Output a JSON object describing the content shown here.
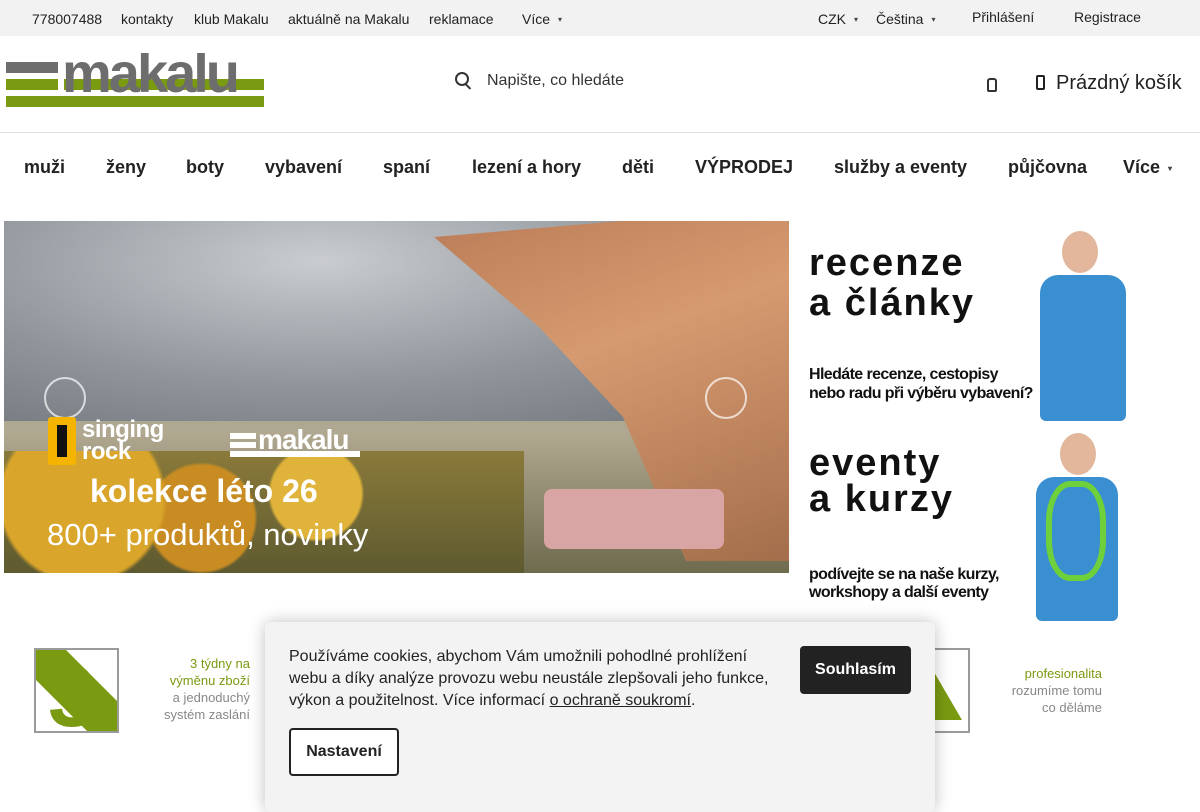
{
  "topbar": {
    "phone": "778007488",
    "links": [
      "kontakty",
      "klub Makalu",
      "aktuálně na Makalu",
      "reklamace"
    ],
    "more": "Více",
    "currency": "CZK",
    "language": "Čeština",
    "login": "Přihlášení",
    "register": "Registrace"
  },
  "header": {
    "logo_text": "makalu",
    "search_placeholder": "Napište, co hledáte",
    "cart_label": "Prázdný košík"
  },
  "nav": {
    "items": [
      "muži",
      "ženy",
      "boty",
      "vybavení",
      "spaní",
      "lezení a hory",
      "děti",
      "VÝPRODEJ",
      "služby a eventy",
      "půjčovna"
    ],
    "more": "Více"
  },
  "hero": {
    "brand1": "singing rock",
    "brand2": "makalu",
    "line1": "kolekce léto 26",
    "line2": "800+ produktů, novinky"
  },
  "side_banners": [
    {
      "title1": "recenze",
      "title2": "a články",
      "sub1": "Hledáte recenze, cestopisy",
      "sub2": "nebo radu při výběru vybavení?"
    },
    {
      "title1": "eventy",
      "title2": "a kurzy",
      "sub1": "podívejte se na naše kurzy,",
      "sub2": "workshopy a další eventy"
    }
  ],
  "benefits": [
    {
      "icon_text": "3",
      "line1": "3 týdny na",
      "line2": "výměnu zboží",
      "line3": "a jednoduchý",
      "line4": "systém zaslání"
    },
    {
      "line1": "profesionalita",
      "line2": "rozumíme tomu",
      "line3": "co děláme"
    }
  ],
  "cookie": {
    "text": "Používáme cookies, abychom Vám umožnili pohodlné prohlížení webu a díky analýze provozu webu neustále zlepšovali jeho funkce, výkon a použitelnost. Více informací ",
    "link": "o ochraně soukromí",
    "end": ".",
    "accept": "Souhlasím",
    "settings": "Nastavení"
  },
  "colors": {
    "brand_green": "#7a9a12",
    "logo_gray": "#6d6d6d",
    "dark": "#222222"
  }
}
